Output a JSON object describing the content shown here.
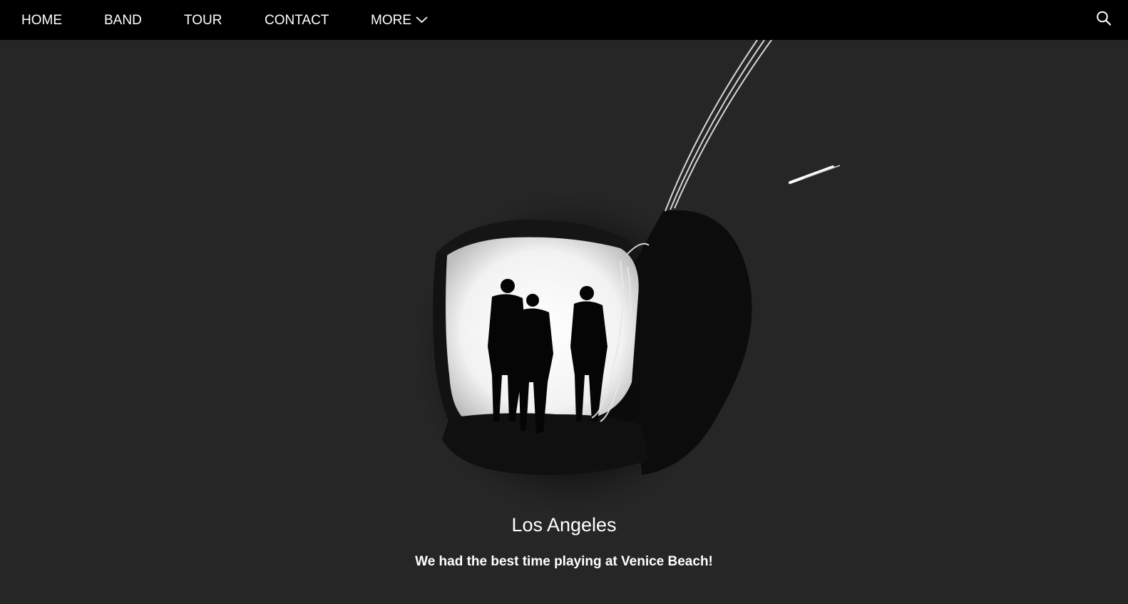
{
  "nav": {
    "items": [
      {
        "label": "HOME"
      },
      {
        "label": "BAND"
      },
      {
        "label": "TOUR"
      },
      {
        "label": "CONTACT"
      },
      {
        "label": "MORE"
      }
    ],
    "more_icon": "chevron-down-icon",
    "search_icon": "search-icon"
  },
  "hero": {
    "title": "Los Angeles",
    "subtitle": "We had the best time playing at Venice Beach!",
    "image_subject": "band-silhouette-in-tunnel"
  },
  "colors": {
    "nav_bg": "#000000",
    "page_bg": "#262626",
    "text": "#ffffff"
  }
}
